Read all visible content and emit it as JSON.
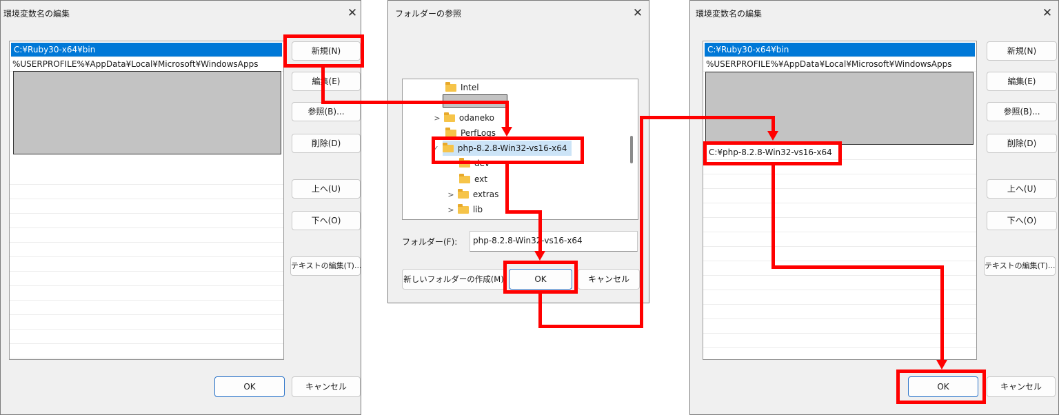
{
  "dialog_left": {
    "title": "環境変数名の編集",
    "items": [
      "C:¥Ruby30-x64¥bin",
      "%USERPROFILE%¥AppData¥Local¥Microsoft¥WindowsApps"
    ],
    "buttons": {
      "new": "新規(N)",
      "edit": "編集(E)",
      "browse": "参照(B)...",
      "delete": "削除(D)",
      "up": "上へ(U)",
      "down": "下へ(O)",
      "edit_text": "テキストの編集(T)...",
      "ok": "OK",
      "cancel": "キャンセル"
    }
  },
  "dialog_mid": {
    "title": "フォルダーの参照",
    "tree": [
      "Intel",
      "odaneko",
      "PerfLogs",
      "php-8.2.8-Win32-vs16-x64",
      "dev",
      "ext",
      "extras",
      "lib"
    ],
    "folder_label": "フォルダー(F):",
    "folder_value": "php-8.2.8-Win32-vs16-x64",
    "buttons": {
      "new_folder": "新しいフォルダーの作成(M)",
      "ok": "OK",
      "cancel": "キャンセル"
    }
  },
  "dialog_right": {
    "title": "環境変数名の編集",
    "items": [
      "C:¥Ruby30-x64¥bin",
      "%USERPROFILE%¥AppData¥Local¥Microsoft¥WindowsApps",
      "C:¥php-8.2.8-Win32-vs16-x64"
    ],
    "buttons": {
      "new": "新規(N)",
      "edit": "編集(E)",
      "browse": "参照(B)...",
      "delete": "削除(D)",
      "up": "上へ(U)",
      "down": "下へ(O)",
      "edit_text": "テキストの編集(T)...",
      "ok": "OK",
      "cancel": "キャンセル"
    }
  },
  "colors": {
    "annotation_red": "#ff0000",
    "selection_blue": "#0078d7",
    "dialog_bg": "#f0f0f0"
  },
  "icons": {
    "close": "close-icon",
    "folder": "folder-icon",
    "chevron": "chevron-right-icon",
    "check": "check-icon"
  }
}
